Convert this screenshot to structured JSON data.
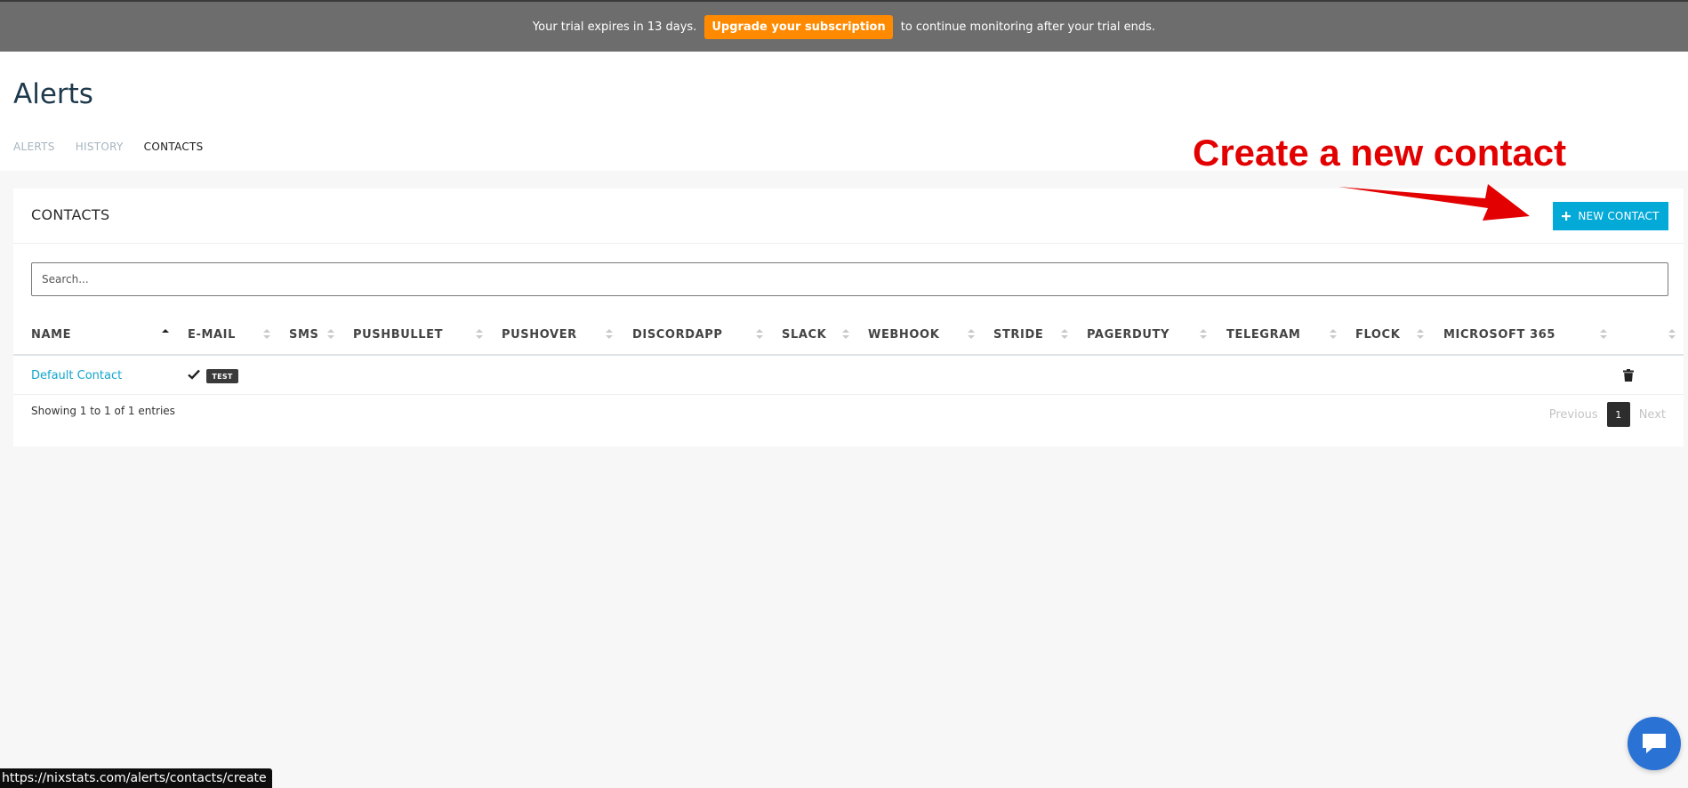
{
  "trial_banner": {
    "text_before": "Your trial expires in 13 days.",
    "upgrade_label": "Upgrade your subscription",
    "text_after": "to continue monitoring after your trial ends."
  },
  "page": {
    "title": "Alerts",
    "tabs": [
      {
        "label": "ALERTS",
        "active": false
      },
      {
        "label": "HISTORY",
        "active": false
      },
      {
        "label": "CONTACTS",
        "active": true
      }
    ]
  },
  "annotation": {
    "text": "Create a new contact",
    "color": "#e30000"
  },
  "contacts_panel": {
    "title": "CONTACTS",
    "new_contact_label": "NEW CONTACT",
    "new_contact_icon": "plus-icon",
    "search_placeholder": "Search...",
    "columns": [
      "NAME",
      "E-MAIL",
      "SMS",
      "PUSHBULLET",
      "PUSHOVER",
      "DISCORDAPP",
      "SLACK",
      "WEBHOOK",
      "STRIDE",
      "PAGERDUTY",
      "TELEGRAM",
      "FLOCK",
      "MICROSOFT 365",
      ""
    ],
    "sorted_column": "NAME",
    "rows": [
      {
        "name": "Default Contact",
        "email_enabled": true,
        "email_icon": "check-icon",
        "test_label": "TEST",
        "delete_icon": "trash-icon"
      }
    ],
    "entries_info": "Showing 1 to 1 of 1 entries",
    "pagination": {
      "previous": "Previous",
      "current": "1",
      "next": "Next"
    }
  },
  "status_bar": {
    "url": "https://nixstats.com/alerts/contacts/create"
  },
  "chat_widget": {
    "icon": "chat-bubble-icon",
    "color": "#2b72d5"
  },
  "colors": {
    "accent": "#03a9d7",
    "upgrade": "#ff8a00",
    "banner_bg": "#6d6d6d",
    "link": "#11a5cc"
  }
}
